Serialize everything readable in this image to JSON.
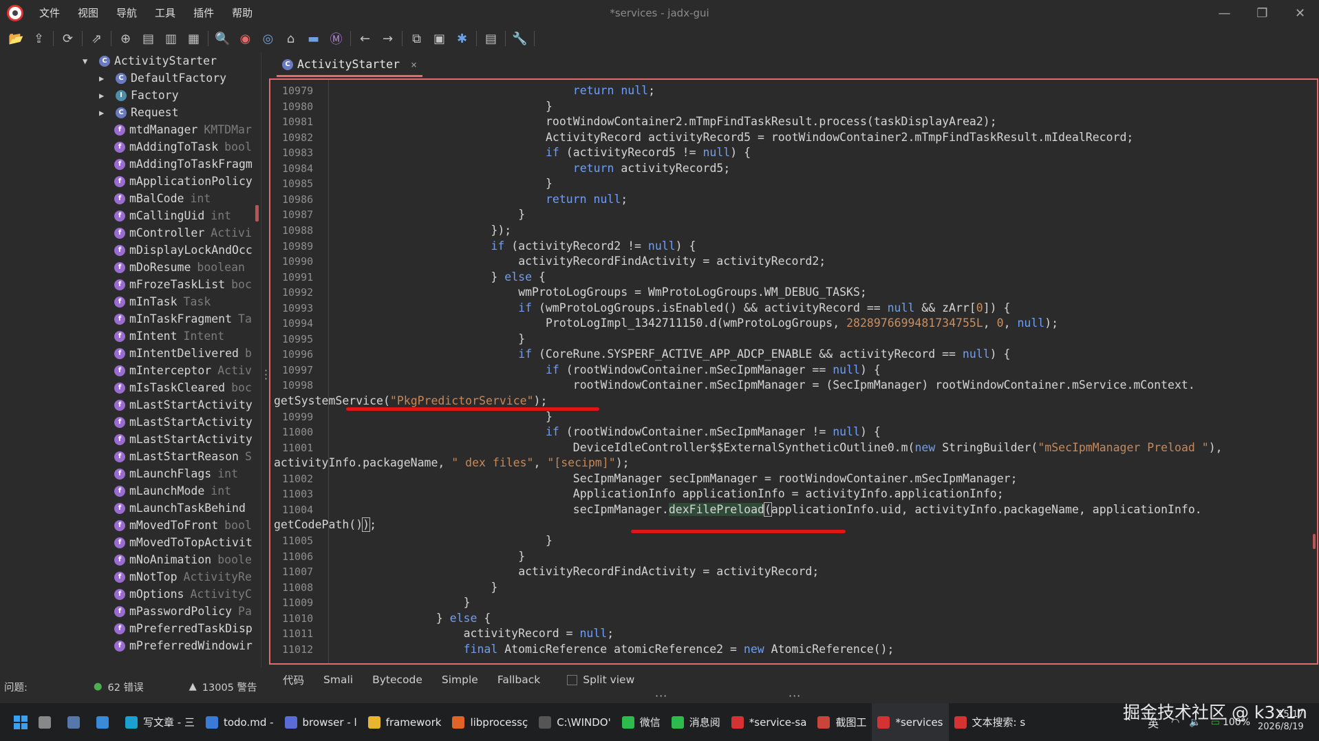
{
  "window": {
    "title": "*services - jadx-gui"
  },
  "menu": [
    "文件",
    "视图",
    "导航",
    "工具",
    "插件",
    "帮助"
  ],
  "tree": {
    "root": "ActivityStarter",
    "children": [
      {
        "name": "DefaultFactory",
        "kind": "class"
      },
      {
        "name": "Factory",
        "kind": "interface"
      },
      {
        "name": "Request",
        "kind": "class"
      }
    ],
    "fields": [
      {
        "name": "mtdManager",
        "type": "KMTDMar"
      },
      {
        "name": "mAddingToTask",
        "type": "bool"
      },
      {
        "name": "mAddingToTaskFragm",
        "type": ""
      },
      {
        "name": "mApplicationPolicy",
        "type": ""
      },
      {
        "name": "mBalCode",
        "type": "int"
      },
      {
        "name": "mCallingUid",
        "type": "int"
      },
      {
        "name": "mController",
        "type": "Activi"
      },
      {
        "name": "mDisplayLockAndOcc",
        "type": ""
      },
      {
        "name": "mDoResume",
        "type": "boolean"
      },
      {
        "name": "mFrozeTaskList",
        "type": "boc"
      },
      {
        "name": "mInTask",
        "type": "Task"
      },
      {
        "name": "mInTaskFragment",
        "type": "Ta"
      },
      {
        "name": "mIntent",
        "type": "Intent"
      },
      {
        "name": "mIntentDelivered",
        "type": "b"
      },
      {
        "name": "mInterceptor",
        "type": "Activ"
      },
      {
        "name": "mIsTaskCleared",
        "type": "boc"
      },
      {
        "name": "mLastStartActivity",
        "type": ""
      },
      {
        "name": "mLastStartActivity",
        "type": ""
      },
      {
        "name": "mLastStartActivity",
        "type": ""
      },
      {
        "name": "mLastStartReason",
        "type": "S"
      },
      {
        "name": "mLaunchFlags",
        "type": "int"
      },
      {
        "name": "mLaunchMode",
        "type": "int"
      },
      {
        "name": "mLaunchTaskBehind",
        "type": ""
      },
      {
        "name": "mMovedToFront",
        "type": "bool"
      },
      {
        "name": "mMovedToTopActivit",
        "type": ""
      },
      {
        "name": "mNoAnimation",
        "type": "boole"
      },
      {
        "name": "mNotTop",
        "type": "ActivityRe"
      },
      {
        "name": "mOptions",
        "type": "ActivityC"
      },
      {
        "name": "mPasswordPolicy",
        "type": "Pa"
      },
      {
        "name": "mPreferredTaskDisp",
        "type": ""
      },
      {
        "name": "mPreferredWindowir",
        "type": ""
      }
    ]
  },
  "editor": {
    "tab_label": "ActivityStarter",
    "tab_close": "×",
    "line_numbers": [
      "10979",
      "10980",
      "10981",
      "10982",
      "10983",
      "10984",
      "10985",
      "10986",
      "10987",
      "10988",
      "10989",
      "10990",
      "10991",
      "10992",
      "10993",
      "10994",
      "10995",
      "10996",
      "10997",
      "10998",
      "10999",
      "11000",
      "11001",
      "11002",
      "11003",
      "11004",
      "11005",
      "11006",
      "11007",
      "11008",
      "11009",
      "11010",
      "11011",
      "11012"
    ],
    "code": {
      "l10979": "return null;",
      "l10980": "}",
      "l10981": "rootWindowContainer2.mTmpFindTaskResult.process(taskDisplayArea2);",
      "l10982": "ActivityRecord activityRecord5 = rootWindowContainer2.mTmpFindTaskResult.mIdealRecord;",
      "l10983": "if (activityRecord5 != null) {",
      "l10984": "return activityRecord5;",
      "l10985": "}",
      "l10986": "return null;",
      "l10987": "}",
      "l10988": "});",
      "l10989": "if (activityRecord2 != null) {",
      "l10990": "activityRecordFindActivity = activityRecord2;",
      "l10991": "} else {",
      "l10992": "wmProtoLogGroups = WmProtoLogGroups.WM_DEBUG_TASKS;",
      "l10993": "if (wmProtoLogGroups.isEnabled() && activityRecord == null && zArr[0]) {",
      "l10994": "ProtoLogImpl_1342711150.d(wmProtoLogGroups, 2828976699481734755L, 0, null);",
      "l10995": "}",
      "l10996": "if (CoreRune.SYSPERF_ACTIVE_APP_ADCP_ENABLE && activityRecord == null) {",
      "l10997": "if (rootWindowContainer.mSecIpmManager == null) {",
      "l10998": "rootWindowContainer.mSecIpmManager = (SecIpmManager) rootWindowContainer.mService.mContext.",
      "l10998b": "getSystemService(\"PkgPredictorService\");",
      "l10999": "}",
      "l11000": "if (rootWindowContainer.mSecIpmManager != null) {",
      "l11001": "DeviceIdleController$$ExternalSyntheticOutline0.m(new StringBuilder(\"mSecIpmManager Preload \"),",
      "l11001b": "activityInfo.packageName, \" dex files\", \"[secipm]\");",
      "l11002": "SecIpmManager secIpmManager = rootWindowContainer.mSecIpmManager;",
      "l11003": "ApplicationInfo applicationInfo = activityInfo.applicationInfo;",
      "l11004": "secIpmManager.dexFilePreload(applicationInfo.uid, activityInfo.packageName, applicationInfo.",
      "l11004b": "getCodePath());",
      "l11005": "}",
      "l11006": "}",
      "l11007": "activityRecordFindActivity = activityRecord;",
      "l11008": "}",
      "l11009": "}",
      "l11010": "} else {",
      "l11011": "activityRecord = null;",
      "l11012": "final AtomicReference atomicReference2 = new AtomicReference();"
    }
  },
  "bottom_tabs": {
    "code": "代码",
    "smali": "Smali",
    "bytecode": "Bytecode",
    "simple": "Simple",
    "fallback": "Fallback",
    "split": "Split view"
  },
  "issues": {
    "label": "问题:",
    "errors": "62 错误",
    "warnings": "13005 警告"
  },
  "taskbar": [
    {
      "label": "写文章 - 三",
      "color": "#1ca0d0"
    },
    {
      "label": "todo.md -",
      "color": "#3a7bd5"
    },
    {
      "label": "browser - l",
      "color": "#5a6dd6"
    },
    {
      "label": "framework",
      "color": "#e8b530"
    },
    {
      "label": "libprocessç",
      "color": "#e0632a"
    },
    {
      "label": "C:\\WINDO'",
      "color": "#555555"
    },
    {
      "label": "微信",
      "color": "#2dbb4d"
    },
    {
      "label": "消息阅",
      "color": "#2dbb4d"
    },
    {
      "label": "*service-sa",
      "color": "#d33333"
    },
    {
      "label": "截图工",
      "color": "#c8453c"
    },
    {
      "label": "*services",
      "color": "#d33333"
    },
    {
      "label": "文本搜索: s",
      "color": "#d33333"
    }
  ],
  "tray": {
    "lang": "英",
    "battery": "100%",
    "time": "15:17",
    "date": "2026/8/19"
  },
  "watermark": "掘金技术社区 @ k3x1n"
}
